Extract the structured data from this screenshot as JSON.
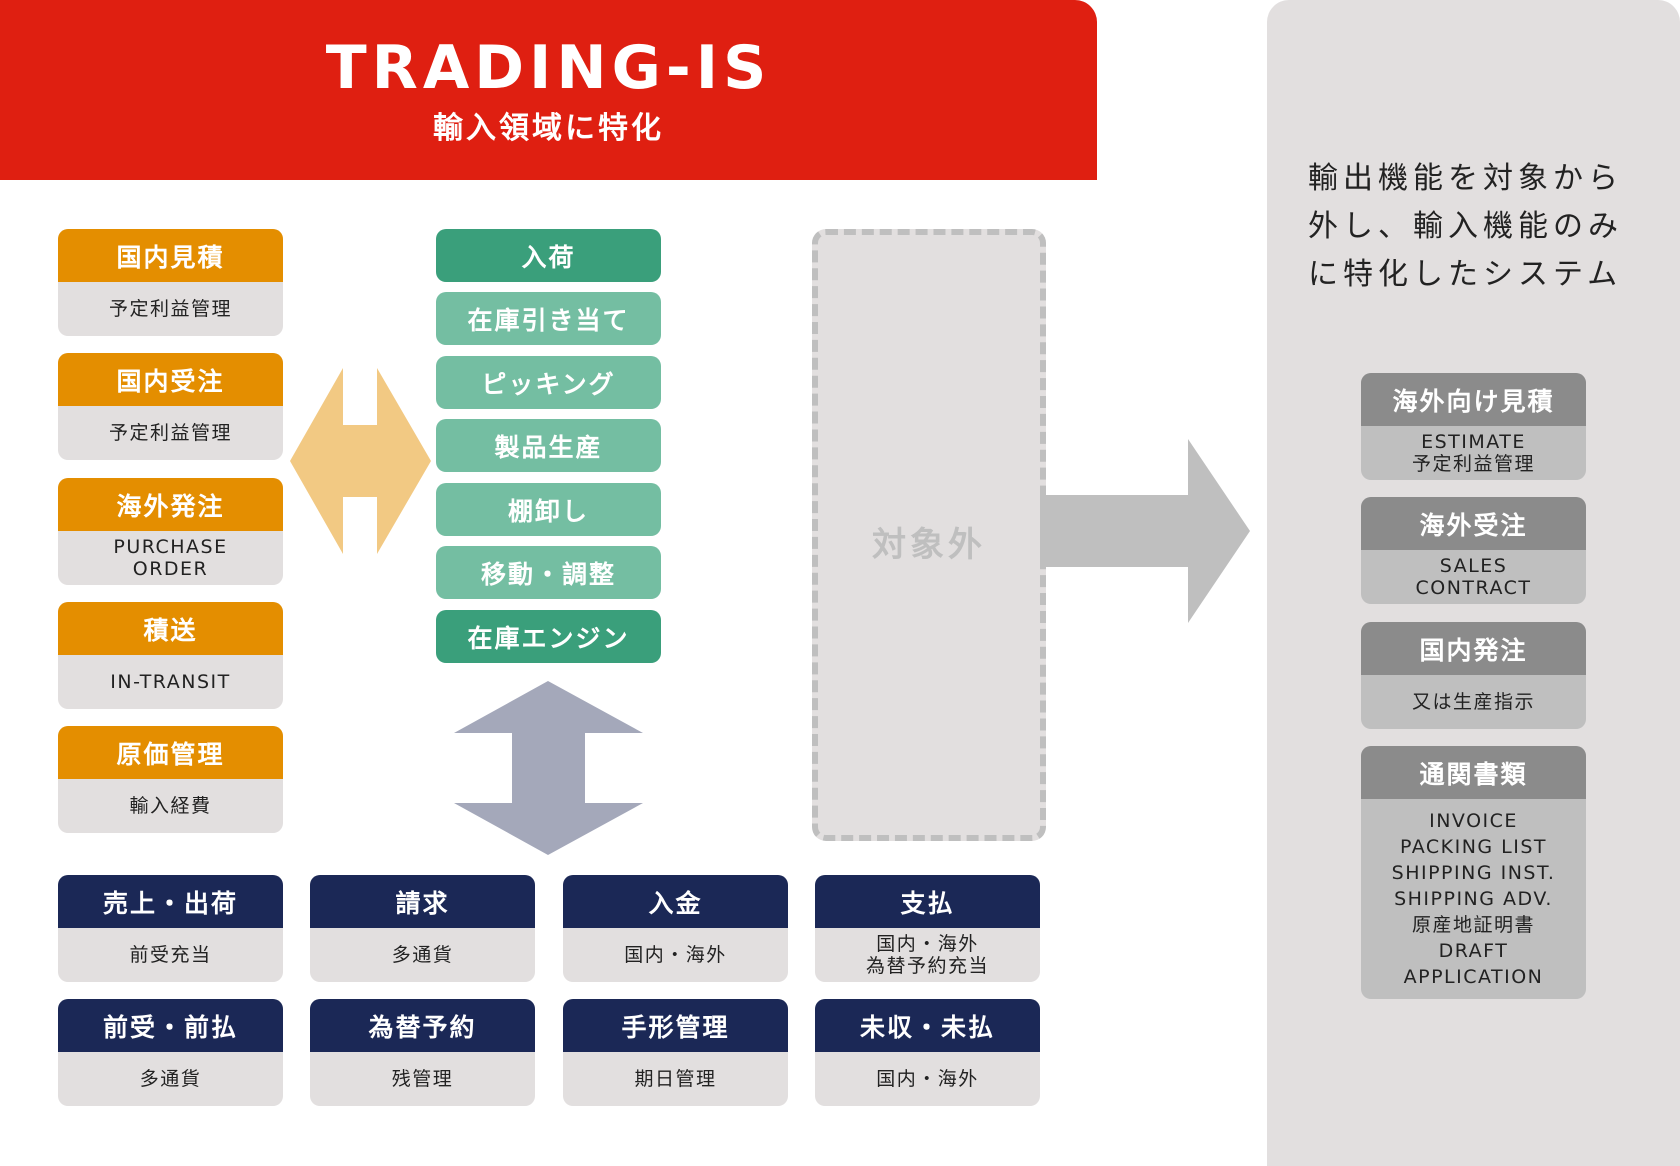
{
  "header": {
    "title": "TRADING-IS",
    "subtitle": "輸入領域に特化"
  },
  "colors": {
    "header_red": "#df1f11",
    "orange": "#e48e00",
    "green_dark": "#3a9f7b",
    "green_light": "#74bea2",
    "navy": "#1b2856",
    "gray_header": "#8b8b8b",
    "gray_body": "#bfbfbf",
    "panel_bg": "#e2dfdf"
  },
  "import_cards": [
    {
      "title": "国内見積",
      "lines": [
        "予定利益管理"
      ]
    },
    {
      "title": "国内受注",
      "lines": [
        "予定利益管理"
      ]
    },
    {
      "title": "海外発注",
      "lines": [
        "PURCHASE",
        "ORDER"
      ]
    },
    {
      "title": "積送",
      "lines": [
        "IN-TRANSIT"
      ]
    },
    {
      "title": "原価管理",
      "lines": [
        "輸入経費"
      ]
    }
  ],
  "inventory_items": [
    {
      "label": "入荷",
      "style": "dark"
    },
    {
      "label": "在庫引き当て",
      "style": "light"
    },
    {
      "label": "ピッキング",
      "style": "light"
    },
    {
      "label": "製品生産",
      "style": "light"
    },
    {
      "label": "棚卸し",
      "style": "light"
    },
    {
      "label": "移動・調整",
      "style": "light"
    },
    {
      "label": "在庫エンジン",
      "style": "dark"
    }
  ],
  "out_of_scope": {
    "label": "対象外"
  },
  "finance_cards": [
    {
      "title": "売上・出荷",
      "lines": [
        "前受充当"
      ]
    },
    {
      "title": "請求",
      "lines": [
        "多通貨"
      ]
    },
    {
      "title": "入金",
      "lines": [
        "国内・海外"
      ]
    },
    {
      "title": "支払",
      "lines": [
        "国内・海外",
        "為替予約充当"
      ]
    },
    {
      "title": "前受・前払",
      "lines": [
        "多通貨"
      ]
    },
    {
      "title": "為替予約",
      "lines": [
        "残管理"
      ]
    },
    {
      "title": "手形管理",
      "lines": [
        "期日管理"
      ]
    },
    {
      "title": "未収・未払",
      "lines": [
        "国内・海外"
      ]
    }
  ],
  "export_panel": {
    "description_lines": [
      "輸出機能を対象から",
      "外し、輸入機能のみ",
      "に特化したシステム"
    ],
    "cards": [
      {
        "title": "海外向け見積",
        "lines": [
          "ESTIMATE",
          "予定利益管理"
        ]
      },
      {
        "title": "海外受注",
        "lines": [
          "SALES",
          "CONTRACT"
        ]
      },
      {
        "title": "国内発注",
        "lines": [
          "又は生産指示"
        ]
      },
      {
        "title": "通関書類",
        "lines": [
          "INVOICE",
          "PACKING LIST",
          "SHIPPING INST.",
          "SHIPPING ADV.",
          "原産地証明書",
          "DRAFT",
          "APPLICATION"
        ]
      }
    ]
  },
  "arrows": [
    {
      "name": "import-inventory",
      "direction": "left-right",
      "color": "#f2c983"
    },
    {
      "name": "inventory-finance",
      "direction": "up-down",
      "color": "#a4a8ba"
    },
    {
      "name": "to-export",
      "direction": "right",
      "color": "#bfbfbf"
    }
  ]
}
